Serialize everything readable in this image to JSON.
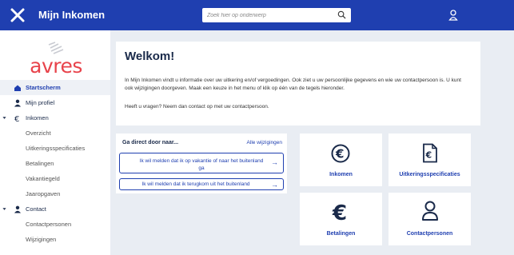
{
  "header": {
    "title": "Mijn Inkomen",
    "search_placeholder": "Zoek hier op onderwerp"
  },
  "logo": {
    "text": "avres"
  },
  "sidebar": {
    "items": [
      {
        "label": "Startscherm",
        "icon": "home-icon",
        "active": true
      },
      {
        "label": "Mijn profiel",
        "icon": "person-icon"
      },
      {
        "label": "Inkomen",
        "icon": "euro-icon",
        "expanded": true
      },
      {
        "label": "Overzicht"
      },
      {
        "label": "Uitkeringsspecificaties"
      },
      {
        "label": "Betalingen"
      },
      {
        "label": "Vakantiegeld"
      },
      {
        "label": "Jaaropgaven"
      },
      {
        "label": "Contact",
        "icon": "contact-icon",
        "expanded": true
      },
      {
        "label": "Contactpersonen"
      },
      {
        "label": "Wijzigingen"
      }
    ]
  },
  "welcome": {
    "title": "Welkom!",
    "para1": "In Mijn Inkomen vindt u informatie over uw uitkering en/of vergoedingen. Ook ziet u uw persoonlijke gegevens en wie uw contactpersoon is. U kunt ook wijzigingen doorgeven. Maak een keuze in het menu of klik op één van de tegels hieronder.",
    "para2": "Heeft u vragen? Neem dan contact op met uw contactpersoon."
  },
  "quick": {
    "title": "Ga direct door naar...",
    "all_link": "Alle wijzigingen",
    "btn1": "Ik wil melden dat ik op vakantie of naar het buitenland ga",
    "btn2": "Ik wil melden dat ik terugkom uit het buitenland"
  },
  "tiles": {
    "inkomen": "Inkomen",
    "uitkeringsspecificaties": "Uitkeringsspecificaties",
    "betalingen": "Betalingen",
    "contactpersonen": "Contactpersonen"
  },
  "colors": {
    "brand": "#1f3fb0",
    "logo": "#e8434b",
    "background": "#e9edf3"
  }
}
